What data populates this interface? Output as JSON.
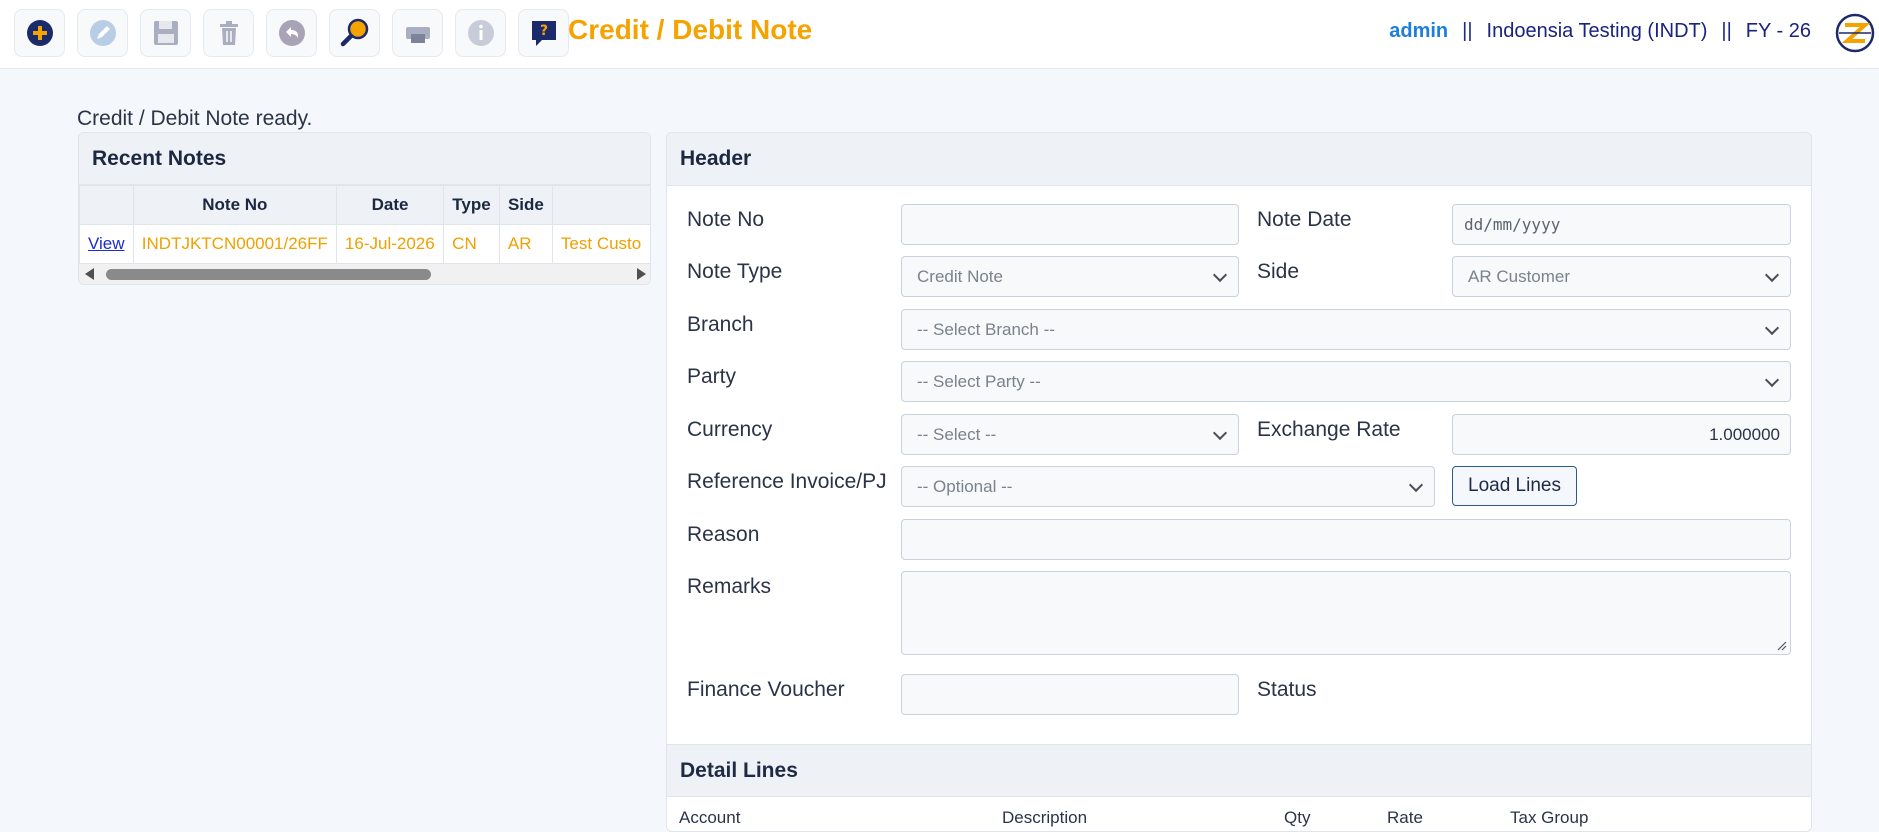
{
  "toolbar": {
    "buttons": [
      {
        "name": "add",
        "icon": "plus-circle-icon"
      },
      {
        "name": "edit",
        "icon": "pencil-icon"
      },
      {
        "name": "save",
        "icon": "floppy-disk-icon"
      },
      {
        "name": "delete",
        "icon": "trash-icon"
      },
      {
        "name": "undo",
        "icon": "undo-icon"
      },
      {
        "name": "search",
        "icon": "magnifier-icon"
      },
      {
        "name": "print",
        "icon": "printer-icon"
      },
      {
        "name": "info",
        "icon": "info-icon"
      },
      {
        "name": "help",
        "icon": "help-chat-icon"
      }
    ],
    "title": "Credit / Debit Note"
  },
  "user_bar": {
    "user": "admin",
    "separator": "||",
    "company": "Indoensia Testing (INDT)",
    "fy": "FY - 26"
  },
  "status_message": "Credit / Debit Note ready.",
  "recent": {
    "title": "Recent Notes",
    "columns": [
      "",
      "Note No",
      "Date",
      "Type",
      "Side",
      ""
    ],
    "rows": [
      {
        "action": "View",
        "note_no": "INDTJKTCN00001/26FF",
        "date": "16-Jul-2026",
        "type": "CN",
        "side": "AR",
        "party": "Test Custo"
      }
    ]
  },
  "header": {
    "title": "Header",
    "labels": {
      "note_no": "Note No",
      "note_date": "Note Date",
      "note_type": "Note Type",
      "side": "Side",
      "branch": "Branch",
      "party": "Party",
      "currency": "Currency",
      "exchange_rate": "Exchange Rate",
      "ref_invoice": "Reference Invoice/PJ",
      "reason": "Reason",
      "remarks": "Remarks",
      "finance_voucher": "Finance Voucher",
      "status": "Status"
    },
    "values": {
      "note_no": "",
      "note_date_placeholder": "dd/mm/yyyy",
      "note_type": "Credit Note",
      "side": "AR Customer",
      "branch": "-- Select Branch --",
      "party": "-- Select Party --",
      "currency": "-- Select --",
      "exchange_rate": "1.000000",
      "ref_invoice": "-- Optional --",
      "reason": "",
      "remarks": "",
      "finance_voucher": ""
    },
    "load_lines_label": "Load Lines"
  },
  "detail": {
    "title": "Detail Lines",
    "columns": [
      "Account",
      "Description",
      "Qty",
      "Rate",
      "Tax Group"
    ]
  },
  "colors": {
    "accent": "#f5a300",
    "link": "#1e7ed8",
    "navy": "#1a237e",
    "row_text": "#f0a000"
  }
}
